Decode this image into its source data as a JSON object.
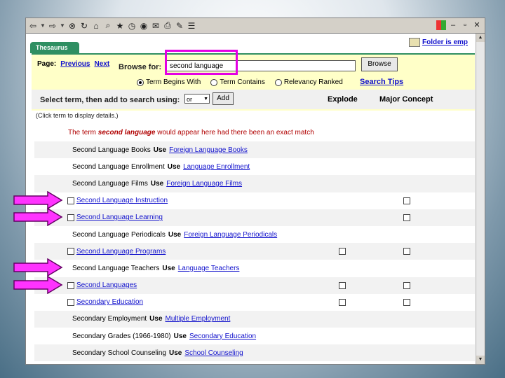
{
  "toolbar": {
    "icons": [
      "back-icon",
      "forward-icon",
      "stop-icon",
      "refresh-icon",
      "home-icon",
      "search-icon",
      "favorites-icon",
      "history-icon",
      "media-icon",
      "mail-icon",
      "print-icon",
      "edit-icon",
      "discuss-icon"
    ]
  },
  "tab": {
    "label": "Thesaurus"
  },
  "folder": {
    "label": "Folder is emp"
  },
  "page_nav": {
    "label": "Page:",
    "previous": "Previous",
    "next": "Next"
  },
  "browse": {
    "label": "Browse for:",
    "value": "second language",
    "button": "Browse"
  },
  "search_mode": {
    "options": [
      {
        "label": "Term Begins With",
        "selected": true
      },
      {
        "label": "Term Contains",
        "selected": false
      },
      {
        "label": "Relevancy Ranked",
        "selected": false
      }
    ],
    "tips_link": "Search Tips"
  },
  "select_bar": {
    "label": "Select term, then add to search using:",
    "operator": "or",
    "add_button": "Add",
    "explode_header": "Explode",
    "major_header": "Major Concept"
  },
  "hint": "(Click term to display details.)",
  "no_match": {
    "prefix": "The term ",
    "term": "second language",
    "suffix": " would appear here had there been an exact match"
  },
  "terms": [
    {
      "term": "Second Language Books",
      "use": "Use",
      "target": "Foreign Language Books",
      "checkbox": false,
      "explode": false,
      "major": false,
      "arrow": false
    },
    {
      "term": "Second Language Enrollment",
      "use": "Use",
      "target": "Language Enrollment",
      "checkbox": false,
      "explode": false,
      "major": false,
      "arrow": false
    },
    {
      "term": "Second Language Films",
      "use": "Use",
      "target": "Foreign Language Films",
      "checkbox": false,
      "explode": false,
      "major": false,
      "arrow": false
    },
    {
      "term": "Second Language Instruction",
      "use": "",
      "target": "",
      "checkbox": true,
      "explode": false,
      "major": true,
      "arrow": true
    },
    {
      "term": "Second Language Learning",
      "use": "",
      "target": "",
      "checkbox": true,
      "explode": false,
      "major": true,
      "arrow": true
    },
    {
      "term": "Second Language Periodicals",
      "use": "Use",
      "target": "Foreign Language Periodicals",
      "checkbox": false,
      "explode": false,
      "major": false,
      "arrow": false
    },
    {
      "term": "Second Language Programs",
      "use": "",
      "target": "",
      "checkbox": true,
      "explode": true,
      "major": true,
      "arrow": false
    },
    {
      "term": "Second Language Teachers",
      "use": "Use",
      "target": "Language Teachers",
      "checkbox": false,
      "explode": false,
      "major": false,
      "arrow": true
    },
    {
      "term": "Second Languages",
      "use": "",
      "target": "",
      "checkbox": true,
      "explode": true,
      "major": true,
      "arrow": true
    },
    {
      "term": "Secondary Education",
      "use": "",
      "target": "",
      "checkbox": true,
      "explode": true,
      "major": true,
      "arrow": false
    },
    {
      "term": "Secondary Employment",
      "use": "Use",
      "target": "Multiple Employment",
      "checkbox": false,
      "explode": false,
      "major": false,
      "arrow": false
    },
    {
      "term": "Secondary Grades (1966-1980)",
      "use": "Use",
      "target": "Secondary Education",
      "checkbox": false,
      "explode": false,
      "major": false,
      "arrow": false
    },
    {
      "term": "Secondary School Counseling",
      "use": "Use",
      "target": "School Counseling",
      "checkbox": false,
      "explode": false,
      "major": false,
      "arrow": false
    }
  ],
  "colors": {
    "arrow": "#ff33ff",
    "highlight": "#e400e4",
    "tab": "#2f8f62",
    "link": "#1111cc"
  }
}
